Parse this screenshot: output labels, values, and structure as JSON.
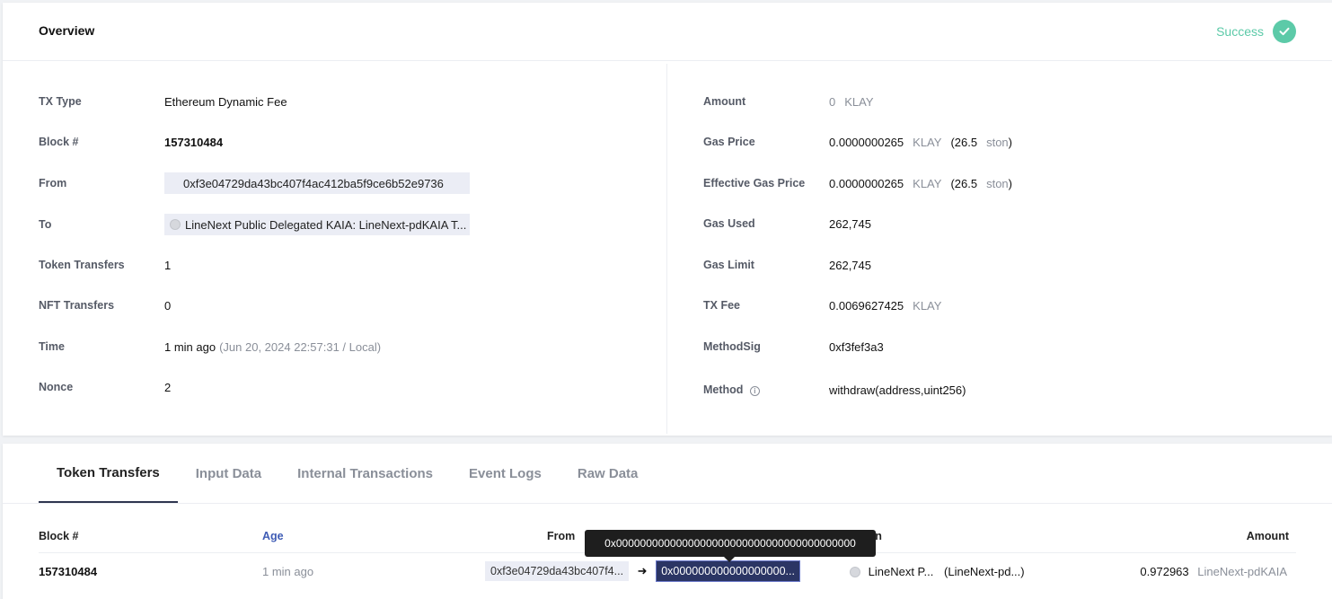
{
  "overview": {
    "title": "Overview",
    "status": "Success"
  },
  "left_fields": {
    "tx_type": {
      "label": "TX Type",
      "value": "Ethereum Dynamic Fee"
    },
    "block": {
      "label": "Block #",
      "value": "157310484"
    },
    "from": {
      "label": "From",
      "value": "0xf3e04729da43bc407f4ac412ba5f9ce6b52e9736"
    },
    "to": {
      "label": "To",
      "value": "LineNext Public Delegated KAIA: LineNext-pdKAIA T..."
    },
    "token_transfers": {
      "label": "Token Transfers",
      "value": "1"
    },
    "nft_transfers": {
      "label": "NFT Transfers",
      "value": "0"
    },
    "time": {
      "label": "Time",
      "value": "1 min ago",
      "detail": "(Jun 20, 2024 22:57:31 / Local)"
    },
    "nonce": {
      "label": "Nonce",
      "value": "2"
    }
  },
  "right_fields": {
    "amount": {
      "label": "Amount",
      "value": "0",
      "unit": "KLAY"
    },
    "gas_price": {
      "label": "Gas Price",
      "value": "0.0000000265",
      "unit": "KLAY",
      "ston_open": "(26.5",
      "ston_unit": "ston",
      "ston_close": ")"
    },
    "effective_gas_price": {
      "label": "Effective Gas Price",
      "value": "0.0000000265",
      "unit": "KLAY",
      "ston_open": "(26.5",
      "ston_unit": "ston",
      "ston_close": ")"
    },
    "gas_used": {
      "label": "Gas Used",
      "value": "262,745"
    },
    "gas_limit": {
      "label": "Gas Limit",
      "value": "262,745"
    },
    "tx_fee": {
      "label": "TX Fee",
      "value": "0.0069627425",
      "unit": "KLAY"
    },
    "method_sig": {
      "label": "MethodSig",
      "value": "0xf3fef3a3"
    },
    "method": {
      "label": "Method",
      "value": "withdraw(address,uint256)"
    }
  },
  "tabs": [
    {
      "label": "Token Transfers",
      "active": true
    },
    {
      "label": "Input Data",
      "active": false
    },
    {
      "label": "Internal Transactions",
      "active": false
    },
    {
      "label": "Event Logs",
      "active": false
    },
    {
      "label": "Raw Data",
      "active": false
    }
  ],
  "transfers_table": {
    "headers": {
      "block": "Block #",
      "age": "Age",
      "from": "From",
      "token": "Token",
      "amount": "Amount"
    },
    "rows": [
      {
        "block": "157310484",
        "age": "1 min ago",
        "from": "0xf3e04729da43bc407f4...",
        "to": "0x000000000000000000...",
        "token_name": "LineNext P...",
        "token_symbol": "(LineNext-pd...)",
        "amount": "0.972963",
        "amount_unit": "LineNext-pdKAIA"
      }
    ]
  },
  "tooltip": "0x0000000000000000000000000000000000000000",
  "colors": {
    "success": "#5ccaa8",
    "to_chip": "#2b3564",
    "age_header": "#3f5cb5"
  }
}
